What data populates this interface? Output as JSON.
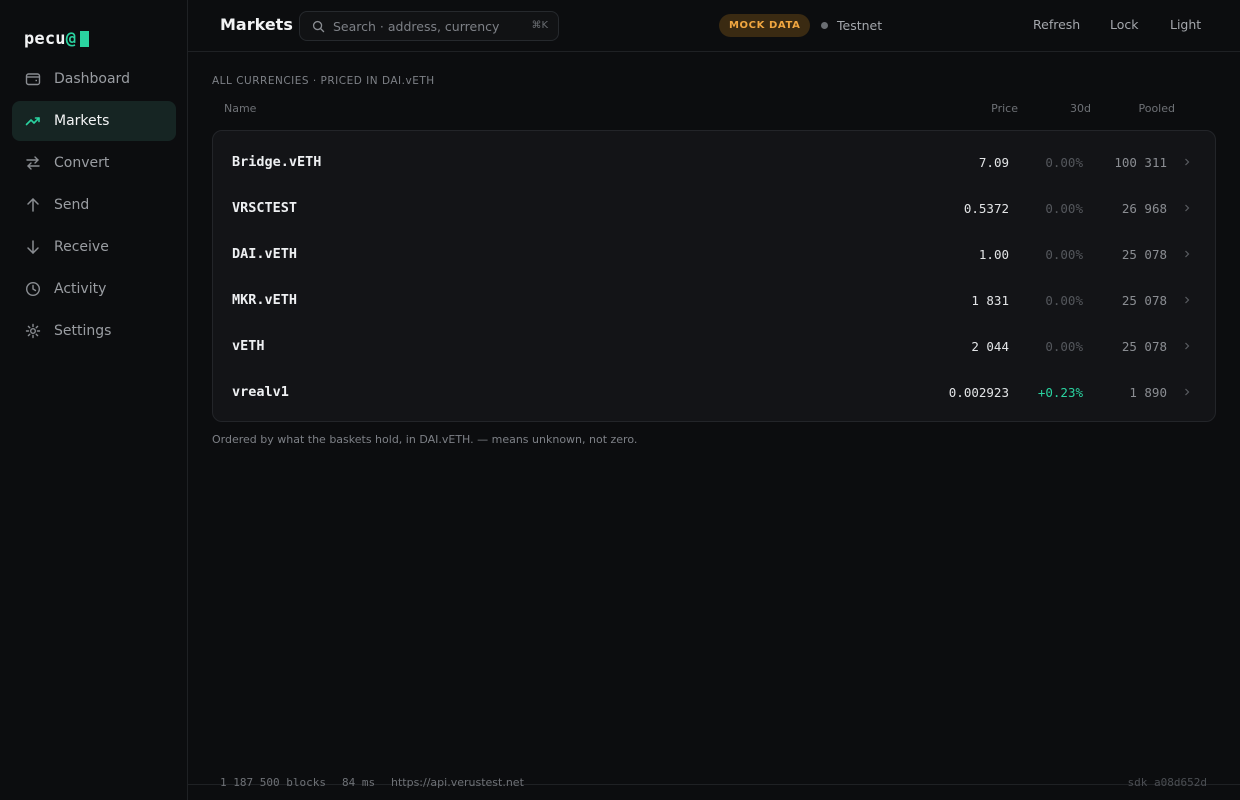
{
  "app": {
    "logo_text": "pecu",
    "logo_at": "@",
    "accent_color": "#2ad3a0"
  },
  "sidebar": {
    "items": [
      {
        "label": "Dashboard",
        "icon": "wallet-icon",
        "active": false
      },
      {
        "label": "Markets",
        "icon": "trending-up-icon",
        "active": true
      },
      {
        "label": "Convert",
        "icon": "swap-icon",
        "active": false
      },
      {
        "label": "Send",
        "icon": "arrow-up-icon",
        "active": false
      },
      {
        "label": "Receive",
        "icon": "arrow-down-icon",
        "active": false
      },
      {
        "label": "Activity",
        "icon": "clock-icon",
        "active": false
      },
      {
        "label": "Settings",
        "icon": "gear-icon",
        "active": false
      }
    ]
  },
  "header": {
    "title": "Markets",
    "search": {
      "placeholder": "Search · address, currency",
      "shortcut": "⌘K"
    },
    "mock_badge": "MOCK DATA",
    "network": "Testnet",
    "buttons": {
      "refresh": "Refresh",
      "lock": "Lock",
      "theme": "Light"
    }
  },
  "main": {
    "section_label": "ALL CURRENCIES · PRICED IN DAI.vETH",
    "columns": {
      "name": "Name",
      "price": "Price",
      "change": "30d",
      "pooled": "Pooled"
    },
    "rows": [
      {
        "name": "Bridge.vETH",
        "price": "7.09",
        "change": "0.00%",
        "pooled": "100 311",
        "positive": false
      },
      {
        "name": "VRSCTEST",
        "price": "0.5372",
        "change": "0.00%",
        "pooled": "26 968",
        "positive": false
      },
      {
        "name": "DAI.vETH",
        "price": "1.00",
        "change": "0.00%",
        "pooled": "25 078",
        "positive": false
      },
      {
        "name": "MKR.vETH",
        "price": "1 831",
        "change": "0.00%",
        "pooled": "25 078",
        "positive": false
      },
      {
        "name": "vETH",
        "price": "2 044",
        "change": "0.00%",
        "pooled": "25 078",
        "positive": false
      },
      {
        "name": "vrealv1",
        "price": "0.002923",
        "change": "+0.23%",
        "pooled": "1 890",
        "positive": true
      }
    ],
    "footnote": "Ordered by what the baskets hold, in DAI.vETH. — means unknown, not zero."
  },
  "status": {
    "blocks": "1 187 500 blocks",
    "latency": "84 ms",
    "api": "https://api.verustest.net",
    "sdk": "sdk a08d652d"
  }
}
